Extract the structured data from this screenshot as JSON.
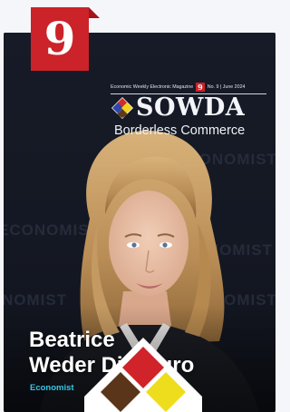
{
  "issue_number": "9",
  "masthead": {
    "tagline": "Economic Weekly Electronic Magazine",
    "tag_number": "9",
    "issue_info": "No. 9 | June 2024",
    "logo_text": "SOWDA",
    "subtitle": "Borderless Commerce"
  },
  "watermark": [
    "ECONOMIST",
    "ECONOMIST",
    "ECONOMIST",
    "NOMIST",
    "ECONOMIST"
  ],
  "person": {
    "name_line1": "Beatrice",
    "name_line2": "Weder Di Mauro",
    "role": "Economist"
  },
  "colors": {
    "accent_red": "#cc2229",
    "role_cyan": "#37c5e8",
    "background": "#12151d"
  }
}
